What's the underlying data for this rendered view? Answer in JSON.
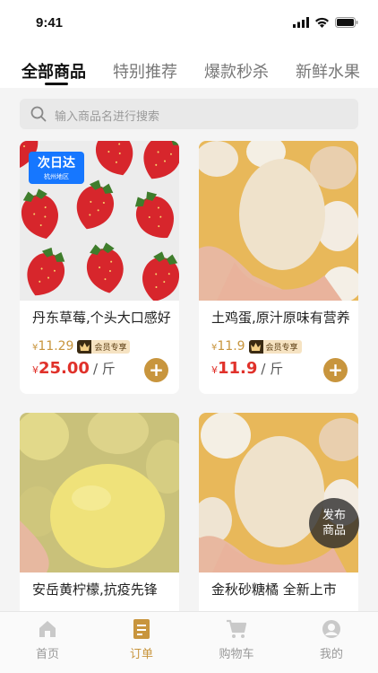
{
  "status": {
    "time": "9:41"
  },
  "tabs": [
    {
      "label": "全部商品",
      "active": true
    },
    {
      "label": "特别推荐"
    },
    {
      "label": "爆款秒杀"
    },
    {
      "label": "新鲜水果"
    }
  ],
  "search": {
    "placeholder": "输入商品名进行搜索"
  },
  "badge": {
    "title": "次日达",
    "subtitle": "杭州地区"
  },
  "member_label": "会员专享",
  "currency": "¥",
  "products": [
    {
      "title": "丹东草莓,个头大口感好",
      "member_price": "11.29",
      "price": "25.00",
      "unit": "/ 斤"
    },
    {
      "title": "土鸡蛋,原汁原味有营养",
      "member_price": "11.9",
      "price": "11.9",
      "unit": "/ 斤"
    },
    {
      "title": "安岳黄柠檬,抗疫先锋",
      "member_price": "",
      "price": "",
      "unit": ""
    },
    {
      "title": "金秋砂糖橘 全新上市",
      "member_price": "",
      "price": "",
      "unit": ""
    }
  ],
  "fab": {
    "line1": "发布",
    "line2": "商品"
  },
  "tabbar": [
    {
      "label": "首页",
      "icon": "home-icon"
    },
    {
      "label": "订单",
      "icon": "order-icon",
      "active": true
    },
    {
      "label": "购物车",
      "icon": "cart-icon"
    },
    {
      "label": "我的",
      "icon": "user-icon"
    }
  ],
  "colors": {
    "accent": "#c8953d",
    "price": "#e0312a",
    "badge_blue": "#1677ff"
  }
}
